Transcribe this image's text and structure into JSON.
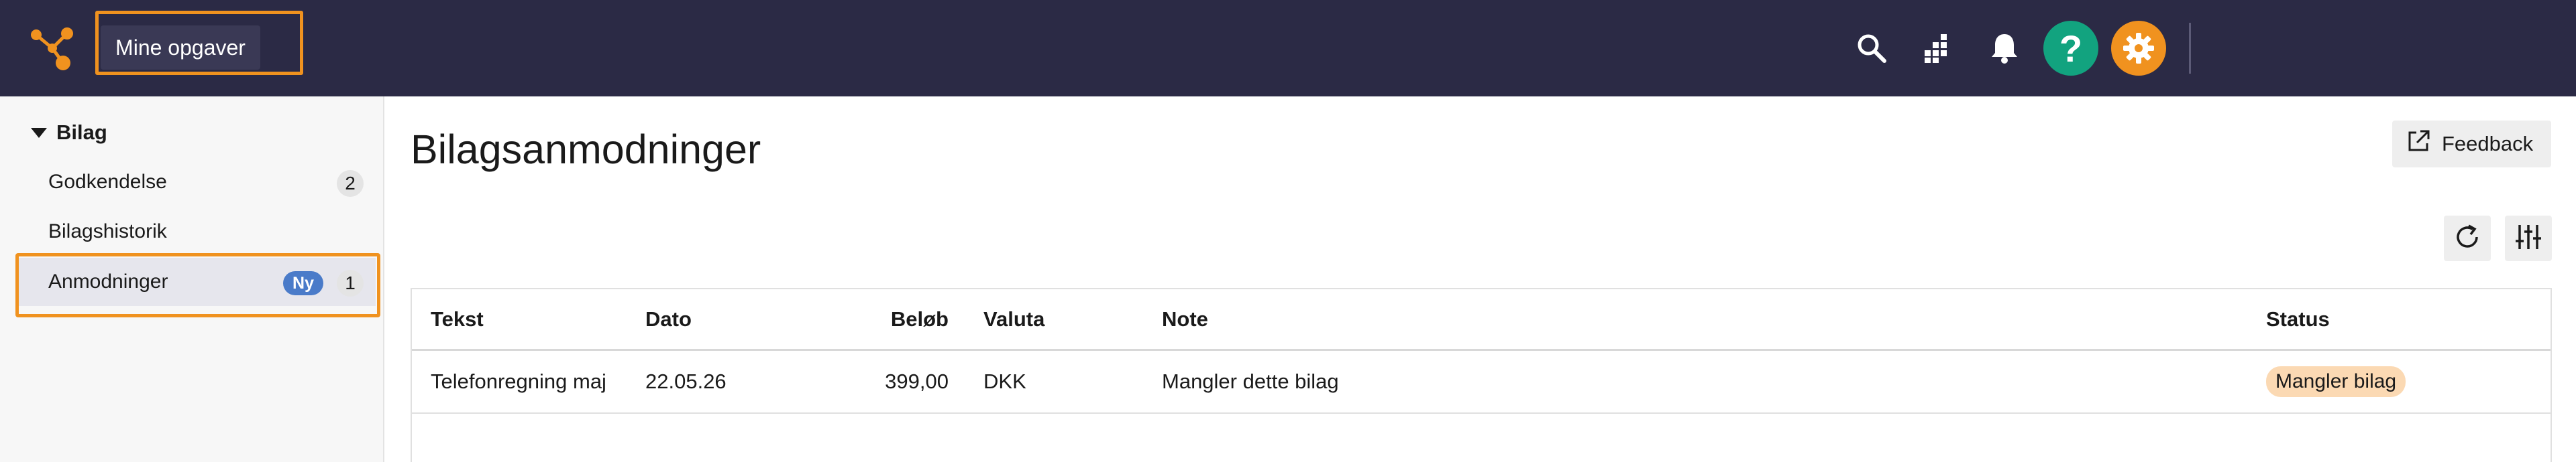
{
  "topbar": {
    "menu_button_label": "Mine opgaver",
    "icons": [
      "logo-icon",
      "search-icon",
      "grid-apps-icon",
      "bell-icon",
      "help-icon",
      "gear-icon"
    ],
    "help_glyph": "?",
    "colors": {
      "bar": "#2b2a45",
      "accent": "#f0921f",
      "help": "#12a37f"
    }
  },
  "sidebar": {
    "section_label": "Bilag",
    "items": [
      {
        "label": "Godkendelse",
        "count": "2"
      },
      {
        "label": "Bilagshistorik"
      },
      {
        "label": "Anmodninger",
        "new_badge": "Ny",
        "count": "1"
      }
    ]
  },
  "main": {
    "title": "Bilagsanmodninger",
    "feedback_label": "Feedback",
    "table": {
      "columns": [
        "Tekst",
        "Dato",
        "Beløb",
        "Valuta",
        "Note",
        "Status"
      ],
      "rows": [
        {
          "tekst": "Telefonregning maj",
          "dato": "22.05.26",
          "belob": "399,00",
          "valuta": "DKK",
          "note": "Mangler dette bilag",
          "status": "Mangler bilag"
        }
      ]
    }
  }
}
